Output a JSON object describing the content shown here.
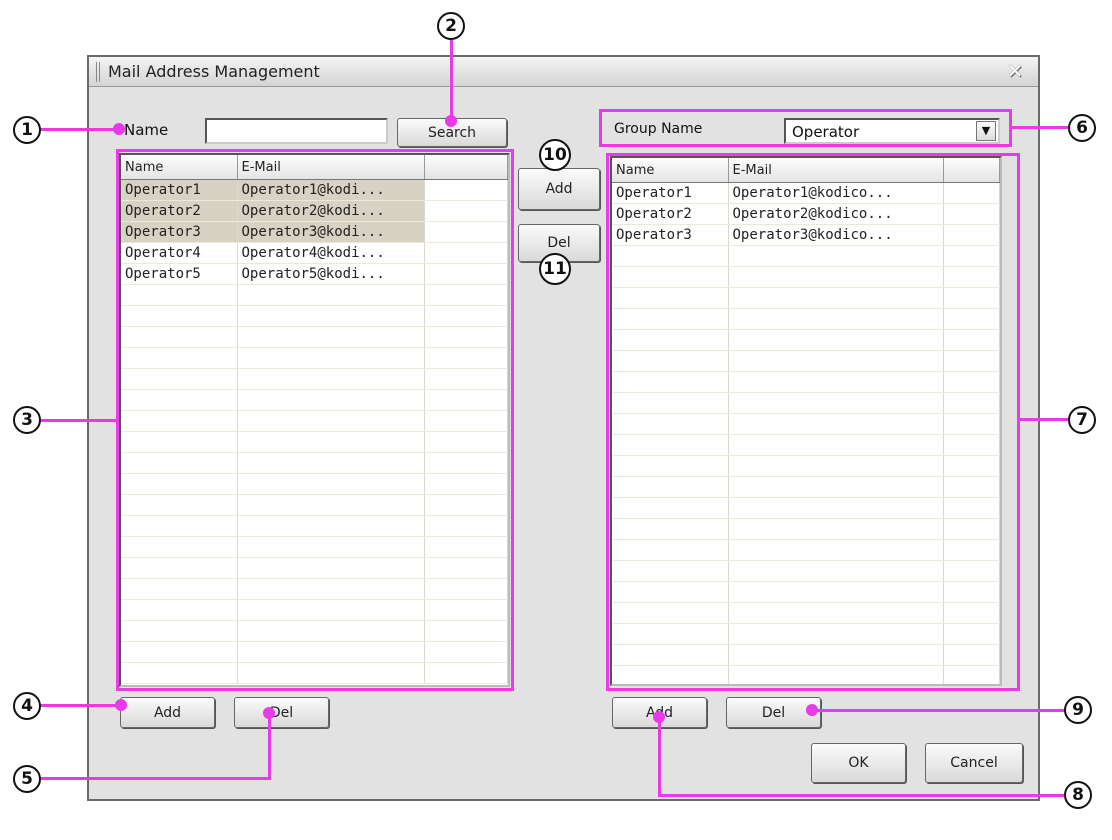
{
  "window": {
    "title": "Mail Address Management",
    "close_glyph": "✕"
  },
  "search": {
    "label": "Name",
    "value": "",
    "button": "Search"
  },
  "left_grid": {
    "columns": [
      "Name",
      "E-Mail"
    ],
    "rows": [
      {
        "name": "Operator1",
        "email": "Operator1@kodi..."
      },
      {
        "name": "Operator2",
        "email": "Operator2@kodi..."
      },
      {
        "name": "Operator3",
        "email": "Operator3@kodi..."
      },
      {
        "name": "Operator4",
        "email": "Operator4@kodi..."
      },
      {
        "name": "Operator5",
        "email": "Operator5@kodi..."
      }
    ]
  },
  "left_buttons": {
    "add": "Add",
    "del": "Del"
  },
  "middle_buttons": {
    "add": "Add",
    "del": "Del"
  },
  "group": {
    "label": "Group Name",
    "selected": "Operator"
  },
  "right_grid": {
    "columns": [
      "Name",
      "E-Mail"
    ],
    "rows": [
      {
        "name": "Operator1",
        "email": "Operator1@kodico..."
      },
      {
        "name": "Operator2",
        "email": "Operator2@kodico..."
      },
      {
        "name": "Operator3",
        "email": "Operator3@kodico..."
      }
    ]
  },
  "right_buttons": {
    "add": "Add",
    "del": "Del"
  },
  "footer": {
    "ok": "OK",
    "cancel": "Cancel"
  },
  "callouts": {
    "c1": "1",
    "c2": "2",
    "c3": "3",
    "c4": "4",
    "c5": "5",
    "c6": "6",
    "c7": "7",
    "c8": "8",
    "c9": "9",
    "c10": "10",
    "c11": "11"
  },
  "colors": {
    "annotation": "#e83ae8",
    "selection": "#d8d2c4",
    "dialog_bg": "#e2e2e2"
  }
}
